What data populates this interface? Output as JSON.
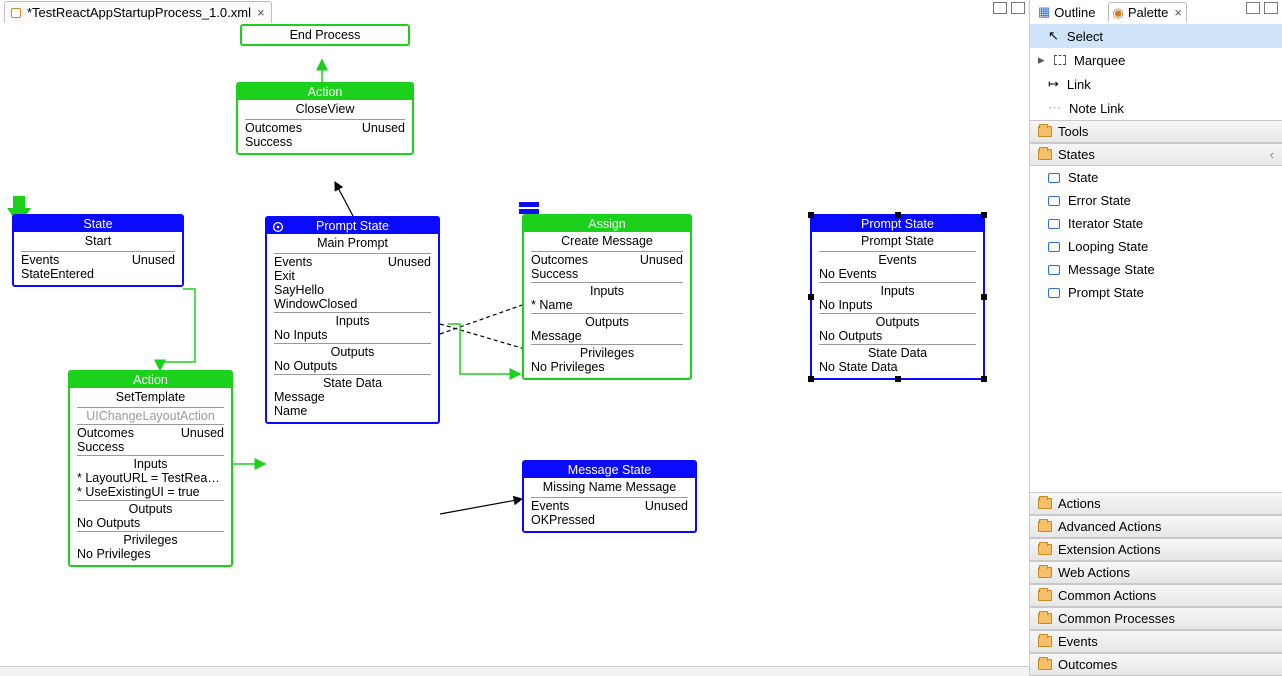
{
  "tab": {
    "filename": "*TestReactAppStartupProcess_1.0.xml"
  },
  "nodes": {
    "start": {
      "title": "State",
      "subtitle": "Start",
      "events_label": "Events",
      "unused_label": "Unused",
      "event1": "StateEntered"
    },
    "end": {
      "subtitle": "End Process"
    },
    "action_close": {
      "title": "Action",
      "subtitle": "CloseView",
      "outcomes_label": "Outcomes",
      "unused_label": "Unused",
      "outcome1": "Success"
    },
    "set_template": {
      "title": "Action",
      "subtitle": "SetTemplate",
      "impl": "UIChangeLayoutAction",
      "outcomes_label": "Outcomes",
      "unused_label": "Unused",
      "outcome1": "Success",
      "inputs_label": "Inputs",
      "input1": "* LayoutURL = TestRea…",
      "input2": "* UseExistingUI = true",
      "outputs_label": "Outputs",
      "outputs_val": "No Outputs",
      "privileges_label": "Privileges",
      "privileges_val": "No Privileges"
    },
    "main_prompt": {
      "title": "Prompt State",
      "subtitle": "Main Prompt",
      "events_label": "Events",
      "unused_label": "Unused",
      "ev1": "Exit",
      "ev2": "SayHello",
      "ev3": "WindowClosed",
      "inputs_label": "Inputs",
      "inputs_val": "No Inputs",
      "outputs_label": "Outputs",
      "outputs_val": "No Outputs",
      "statedata_label": "State Data",
      "sd1": "Message",
      "sd2": "Name"
    },
    "assign": {
      "title": "Assign",
      "subtitle": "Create Message",
      "outcomes_label": "Outcomes",
      "unused_label": "Unused",
      "outcome1": "Success",
      "inputs_label": "Inputs",
      "input1": "* Name",
      "outputs_label": "Outputs",
      "output1": "Message",
      "privileges_label": "Privileges",
      "privileges_val": "No Privileges"
    },
    "msg_state": {
      "title": "Message State",
      "subtitle": "Missing Name Message",
      "events_label": "Events",
      "unused_label": "Unused",
      "ev1": "OKPressed"
    },
    "prompt_state2": {
      "title": "Prompt State",
      "subtitle": "Prompt State",
      "events_label": "Events",
      "events_val": "No Events",
      "inputs_label": "Inputs",
      "inputs_val": "No Inputs",
      "outputs_label": "Outputs",
      "outputs_val": "No Outputs",
      "statedata_label": "State Data",
      "statedata_val": "No State Data"
    }
  },
  "palette": {
    "outline_tab": "Outline",
    "palette_tab": "Palette",
    "tools": {
      "select": "Select",
      "marquee": "Marquee",
      "link": "Link",
      "notelink": "Note Link"
    },
    "drawers": {
      "tools": "Tools",
      "states": "States",
      "actions": "Actions",
      "adv_actions": "Advanced Actions",
      "ext_actions": "Extension Actions",
      "web_actions": "Web Actions",
      "common_actions": "Common Actions",
      "common_processes": "Common Processes",
      "events": "Events",
      "outcomes": "Outcomes"
    },
    "states": {
      "state": "State",
      "error": "Error State",
      "iterator": "Iterator State",
      "looping": "Looping State",
      "message": "Message State",
      "prompt": "Prompt State"
    }
  }
}
